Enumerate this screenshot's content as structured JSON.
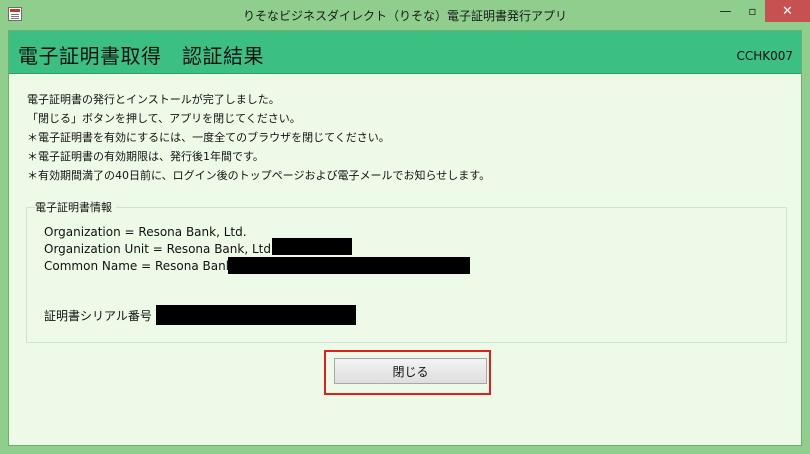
{
  "window": {
    "title": "りそなビジネスダイレクト（りそな）電子証明書発行アプリ",
    "controls": {
      "minimize": "—",
      "maximize": "▫",
      "close": "✕"
    }
  },
  "header": {
    "title": "電子証明書取得　認証結果",
    "screen_id": "CCHK007"
  },
  "messages": [
    "電子証明書の発行とインストールが完了しました。",
    "「閉じる」ボタンを押して、アプリを閉じてください。",
    "＊電子証明書を有効にするには、一度全てのブラウザを閉じてください。",
    "＊電子証明書の有効期限は、発行後1年間です。",
    "＊有効期間満了の40日前に、ログイン後のトップページおよび電子メールでお知らせします。"
  ],
  "cert_info": {
    "legend": "電子証明書情報",
    "organization": "Organization = Resona Bank, Ltd.",
    "organization_unit": "Organization Unit = Resona Bank, Ltd.",
    "common_name": "Common Name = Resona Bank",
    "serial_label": "証明書シリアル番号 ="
  },
  "buttons": {
    "close_label": "閉じる"
  },
  "colors": {
    "window_frame": "#8fce8c",
    "header_band": "#3cbf83",
    "client_bg": "#eefae8",
    "highlight": "#e0201e"
  }
}
